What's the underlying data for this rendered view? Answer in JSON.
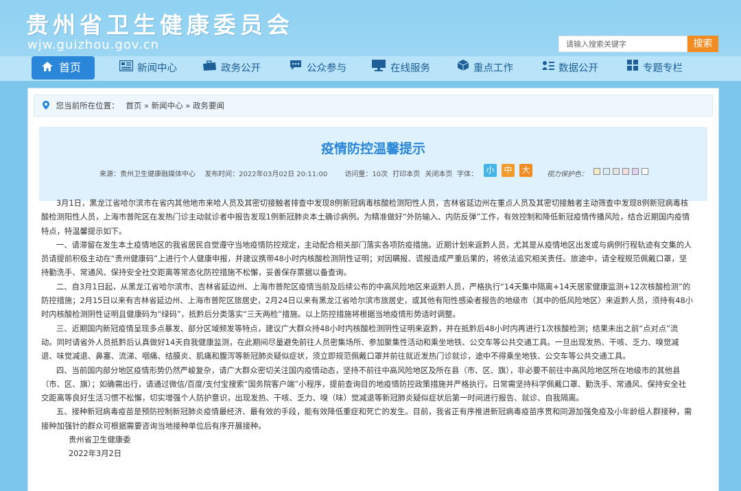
{
  "header": {
    "title": "贵州省卫生健康委员会",
    "url": "wjw.guizhou.gov.cn",
    "search_placeholder": "请输入搜索关键字",
    "search_button": "搜索"
  },
  "nav": {
    "home": "首页",
    "items": [
      "新闻中心",
      "政务公开",
      "公众参与",
      "在线服务",
      "重点工作",
      "数据公开",
      "专题专栏"
    ]
  },
  "breadcrumb": {
    "prefix": "您当前所在位置：",
    "path": "首页 » 新闻中心 » 政务要闻"
  },
  "article": {
    "title": "疫情防控温馨提示",
    "source": "来源：贵州卫生健康融媒体中心",
    "published": "发布时间：2022年03月02日 20:11:00",
    "views": "访问量：10次",
    "print": "打印本页",
    "close": "关闭本页",
    "font_label": "字体：",
    "font_small": "小",
    "font_medium": "中",
    "font_large": "大",
    "eye_label": "视力保护色：",
    "swatches": [
      "#f5e8c7",
      "#d7ebf7",
      "#e3e3e3",
      "#f2dede",
      "#e3d1f2",
      "#ffffff"
    ],
    "paragraphs": [
      "3月1日，黑龙江省哈尔滨市在省内其他地市来哈人员及其密切接触者排查中发现8例新冠病毒核酸检测阳性人员，吉林省延边州在重点人员及其密切接触者主动筛查中发现8例新冠病毒核酸检测阳性人员，上海市普陀区在发热门诊主动就诊者中报告发现1例新冠肺炎本土确诊病例。为精准做好“外防输入、内防反弹”工作，有效控制和降低新冠疫情传播风险，结合近期国内疫情特点，特温馨提示如下。",
      "一、请滞留在发生本土疫情地区的我省居民自觉遵守当地疫情防控规定，主动配合相关部门落实各项防疫措施。近期计划来返黔人员，尤其是从疫情地区出发或与病例行程轨迹有交集的人员请提前积极主动在“贵州健康码”上进行个人健康申报，并建议携带48小时内核酸检测阴性证明；对因瞒报、谎报造成严重后果的，将依法追究相关责任。旅途中，请全程规范佩戴口罩，坚持勤洗手、常通风、保持安全社交距离等常态化防控措施不松懈，妥善保存票据以备查询。",
      "二、自3月1日起，从黑龙江省哈尔滨市、吉林省延边州、上海市普陀区疫情当前及后续公布的中高风险地区来返黔人员，严格执行“14天集中隔离+14天居家健康监测+12次核酸检测”的防控措施；2月15日以来有吉林省延边州、上海市普陀区旅居史，2月24日以来有黑龙江省哈尔滨市旅居史，或其他有阳性感染者报告的地级市（其中的低风险地区）来返黔人员，须持有48小时内核酸检测阴性证明且健康码为“绿码”，抵黔后分类落实“三天两检”措施。以上防控措施将根据当地疫情形势适时调整。",
      "三、近期国内新冠疫情呈现多点暴发、部分区域频发等特点，建议广大群众持48小时内核酸检测阴性证明来返黔，并在抵黔后48小时内再进行1次核酸检测；结果未出之前“点对点”流动。同时请省外人员抵黔后认真做好14天自我健康监测，在此期间尽量避免前往人员密集场所、参加聚集性活动和乘坐地铁、公交车等公共交通工具。一旦出现发热、干咳、乏力、嗅觉减退、味觉减退、鼻塞、流涕、咽痛、结膜炎、肌痛和腹泻等新冠肺炎疑似症状，须立即规范佩戴口罩并前往就近发热门诊就诊，途中不得乘坐地铁、公交车等公共交通工具。",
      "四、当前国内部分地区疫情形势仍然严峻复杂，请广大群众密切关注国内疫情动态，坚持不前往中高风险地区及所在县（市、区、旗），非必要不前往中高风险地区所在地级市的其他县（市、区、旗）；如确需出行，请通过微信/百度/支付宝搜索“国务院客户端”小程序，提前查询目的地疫情防控政策措施并严格执行。日常需坚持科学佩戴口罩、勤洗手、常通风、保持安全社交距离等良好生活习惯不松懈，切实增强个人防护意识，出现发热、干咳、乏力、嗅（味）觉减退等新冠肺炎疑似症状后第一时间进行报告、就诊、自我隔离。",
      "五、接种新冠病毒疫苗是预防控制新冠肺炎疫情最经济、最有效的手段，能有效降低重症和死亡的发生。目前，我省正有序推进新冠病毒疫苗序贯和同源加强免疫及小年龄组人群接种，需接种加强针的群众可根据需要咨询当地接种单位后有序开展接种。"
    ],
    "signature": "贵州省卫生健康委",
    "date": "2022年3月2日"
  }
}
